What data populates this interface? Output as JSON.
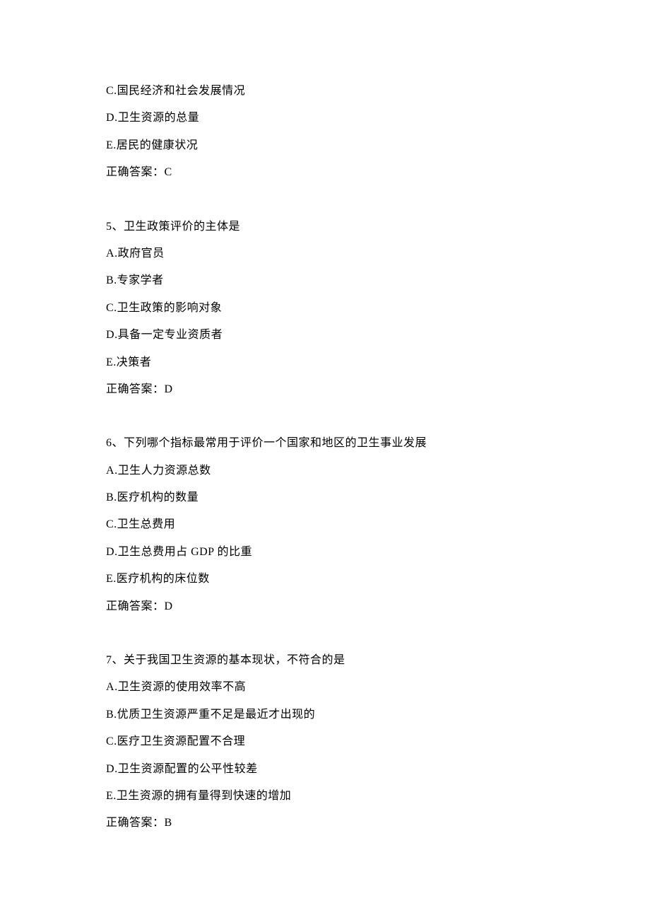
{
  "partial": {
    "options": [
      {
        "letter": "C",
        "text": "国民经济和社会发展情况"
      },
      {
        "letter": "D",
        "text": "卫生资源的总量"
      },
      {
        "letter": "E",
        "text": "居民的健康状况"
      }
    ],
    "answer_label": "正确答案：",
    "answer": "C"
  },
  "questions": [
    {
      "number": "5、",
      "stem": "卫生政策评价的主体是",
      "options": [
        {
          "letter": "A",
          "text": "政府官员"
        },
        {
          "letter": "B",
          "text": "专家学者"
        },
        {
          "letter": "C",
          "text": "卫生政策的影响对象"
        },
        {
          "letter": "D",
          "text": "具备一定专业资质者"
        },
        {
          "letter": "E",
          "text": "决策者"
        }
      ],
      "answer_label": "正确答案：",
      "answer": "D"
    },
    {
      "number": "6、",
      "stem": "下列哪个指标最常用于评价一个国家和地区的卫生事业发展",
      "options": [
        {
          "letter": "A",
          "text": "卫生人力资源总数"
        },
        {
          "letter": "B",
          "text": "医疗机构的数量"
        },
        {
          "letter": "C",
          "text": "卫生总费用"
        },
        {
          "letter": "D",
          "text": "卫生总费用占 GDP 的比重"
        },
        {
          "letter": "E",
          "text": "医疗机构的床位数"
        }
      ],
      "answer_label": "正确答案：",
      "answer": "D"
    },
    {
      "number": "7、",
      "stem": "关于我国卫生资源的基本现状，不符合的是",
      "options": [
        {
          "letter": "A",
          "text": "卫生资源的使用效率不高"
        },
        {
          "letter": "B",
          "text": "优质卫生资源严重不足是最近才出现的"
        },
        {
          "letter": "C",
          "text": "医疗卫生资源配置不合理"
        },
        {
          "letter": "D",
          "text": "卫生资源配置的公平性较差"
        },
        {
          "letter": "E",
          "text": "卫生资源的拥有量得到快速的增加"
        }
      ],
      "answer_label": "正确答案：",
      "answer": "B"
    }
  ]
}
